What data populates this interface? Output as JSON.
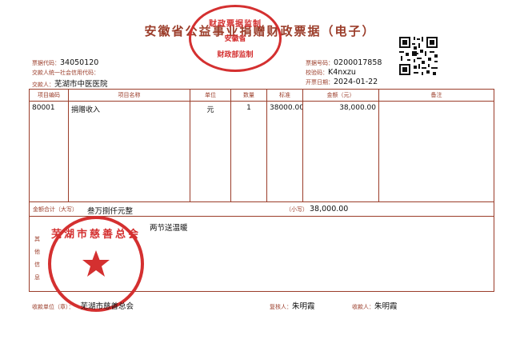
{
  "doc": {
    "title": "安徽省公益事业捐赠财政票据（电子）"
  },
  "header_left": {
    "code_label": "票据代码：",
    "code_value": "34050120",
    "credit_label": "交款人统一社会信用代码：",
    "credit_value": "",
    "payer_label": "交款人：",
    "payer_value": "芜湖市中医医院"
  },
  "header_right": {
    "number_label": "票据号码：",
    "number_value": "0200017858",
    "check_label": "校验码：",
    "check_value": "K4nxzu",
    "date_label": "开票日期：",
    "date_value": "2024-01-22"
  },
  "table": {
    "headers": [
      "项目编码",
      "项目名称",
      "单位",
      "数量",
      "标准",
      "金额（元）",
      "备注"
    ],
    "rows": [
      {
        "code": "80001",
        "name": "捐赠收入",
        "unit": "元",
        "qty": "1",
        "standard": "38000.00",
        "amount": "38,000.00",
        "note": ""
      }
    ],
    "total_label": "金额合计（大写）",
    "total_upper": "叁万捌仟元整",
    "small_label": "（小写）",
    "total_lower": "38,000.00"
  },
  "other": {
    "label": "其他信息",
    "text": "两节送温暖"
  },
  "footer": {
    "unit_label": "收款单位（章）：",
    "unit_value": "芜湖市慈善总会",
    "reviewer_label": "复核人：",
    "reviewer_value": "朱明霞",
    "collector_label": "收款人：",
    "collector_value": "朱明霞"
  },
  "seal_top": {
    "line1": "财政票据监制",
    "line2": "安徽省",
    "line3": "财政部监制"
  },
  "seal_bottom": {
    "text": "芜湖市慈善总会"
  },
  "colors": {
    "frame": "#9b3d2a",
    "seal": "#d43030"
  }
}
